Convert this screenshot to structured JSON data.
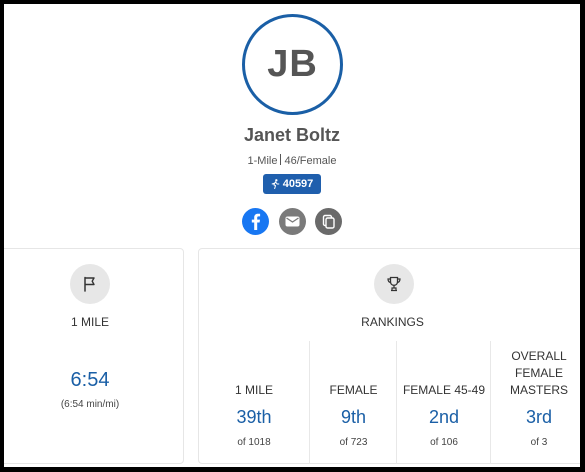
{
  "profile": {
    "initials": "JB",
    "name": "Janet Boltz",
    "event": "1-Mile",
    "age_gender": "46/Female",
    "bib": "40597"
  },
  "social": {
    "facebook_icon": "facebook-icon",
    "email_icon": "mail-icon",
    "copy_icon": "copy-icon"
  },
  "result": {
    "icon": "flag-icon",
    "title": "1 MILE",
    "time": "6:54",
    "pace": "(6:54 min/mi)"
  },
  "rankings": {
    "icon": "trophy-icon",
    "title": "RANKINGS",
    "items": [
      {
        "label": "1 MILE",
        "rank": "39th",
        "of": "of 1018"
      },
      {
        "label": "FEMALE",
        "rank": "9th",
        "of": "of 723"
      },
      {
        "label": "FEMALE 45-49",
        "rank": "2nd",
        "of": "of 106"
      },
      {
        "label": "OVERALL FEMALE MASTERS",
        "rank": "3rd",
        "of": "of 3"
      }
    ]
  },
  "colors": {
    "accent": "#1a5fa6",
    "bib_background": "#1f5fad",
    "facebook": "#1877f2"
  }
}
